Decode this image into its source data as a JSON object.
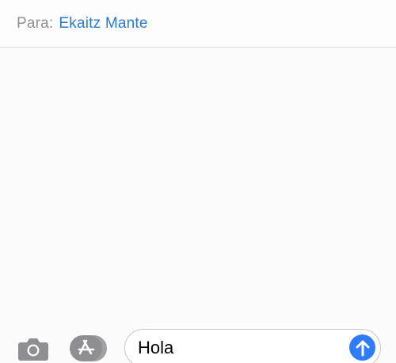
{
  "header": {
    "to_label": "Para:",
    "recipient": "Ekaitz Mante"
  },
  "compose": {
    "camera_icon": "camera-icon",
    "apps_icon": "app-store-icon",
    "message_value": "Hola",
    "send_icon": "arrow-up-icon"
  },
  "colors": {
    "accent": "#2a7ad4",
    "send_button": "#2f7cf6",
    "icon_gray": "#8e8e93"
  }
}
